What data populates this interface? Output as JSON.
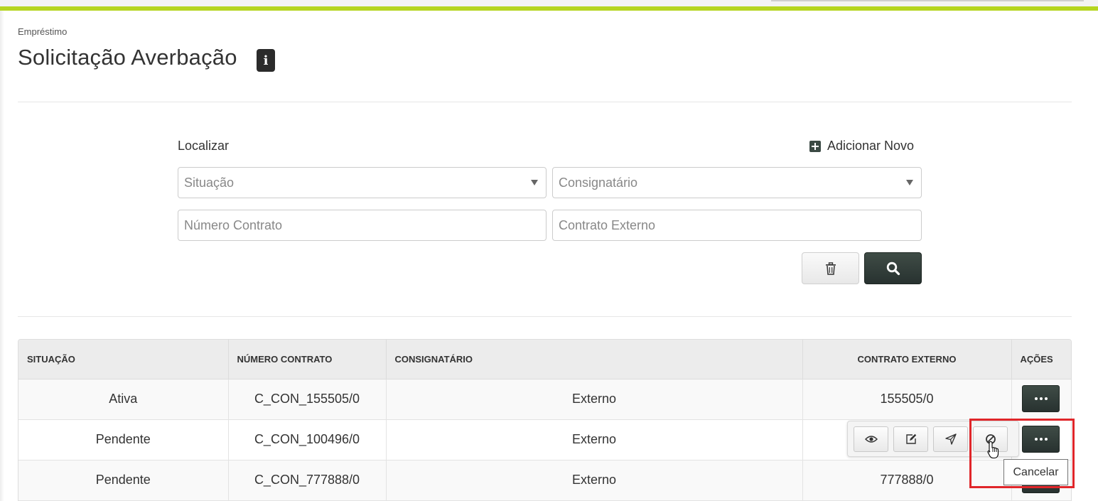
{
  "breadcrumb": "Empréstimo",
  "page": {
    "title": "Solicitação Averbação",
    "info_icon_glyph": "i"
  },
  "filter": {
    "title": "Localizar",
    "add_new_label": "Adicionar Novo",
    "situacao_placeholder": "Situação",
    "consignatario_placeholder": "Consignatário",
    "numero_contrato_placeholder": "Número Contrato",
    "contrato_externo_placeholder": "Contrato Externo"
  },
  "table": {
    "headers": [
      "SITUAÇÃO",
      "NÚMERO CONTRATO",
      "CONSIGNATÁRIO",
      "CONTRATO EXTERNO",
      "AÇÕES"
    ],
    "rows": [
      {
        "situacao": "Ativa",
        "numero_contrato": "C_CON_155505/0",
        "consignatario": "Externo",
        "contrato_externo": "155505/0"
      },
      {
        "situacao": "Pendente",
        "numero_contrato": "C_CON_100496/0",
        "consignatario": "Externo",
        "contrato_externo": ""
      },
      {
        "situacao": "Pendente",
        "numero_contrato": "C_CON_777888/0",
        "consignatario": "Externo",
        "contrato_externo": "777888/0"
      }
    ]
  },
  "row_actions": {
    "icons": [
      "eye-icon",
      "edit-icon",
      "send-icon",
      "cancel-icon"
    ]
  },
  "tooltip": "Cancelar",
  "colors": {
    "accent_bar": "#b5d51f",
    "dark_button": "#2f3a35",
    "highlight": "#e0262a"
  }
}
